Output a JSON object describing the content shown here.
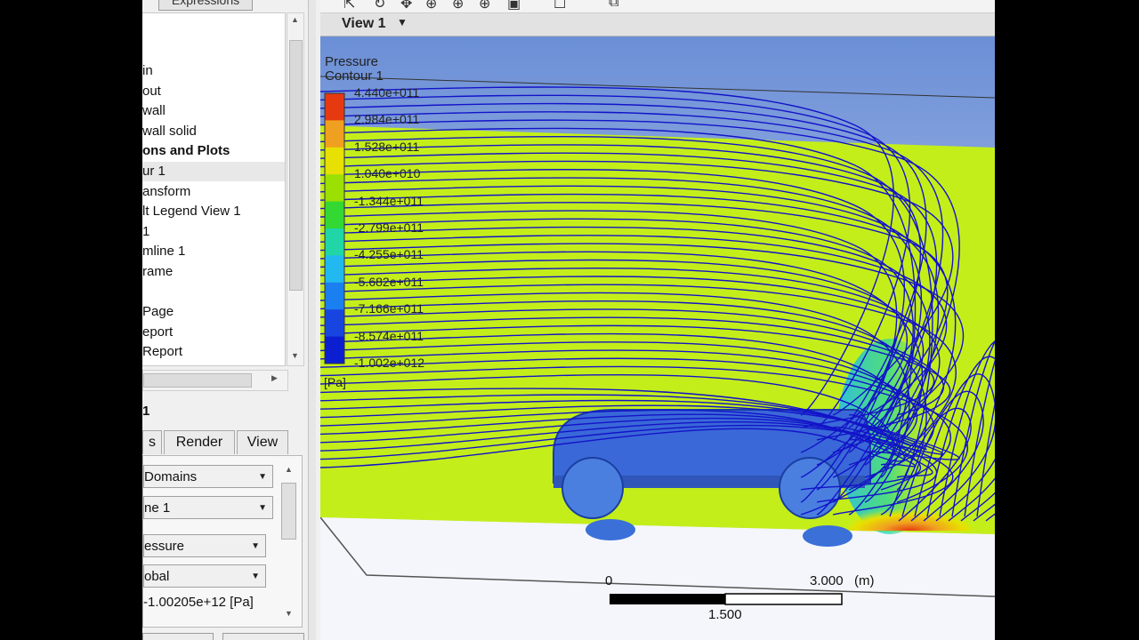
{
  "left_panel": {
    "top_tab": "Expressions",
    "tree_items": [
      {
        "label": "in",
        "bold": false,
        "selected": false
      },
      {
        "label": "out",
        "bold": false,
        "selected": false
      },
      {
        "label": "wall",
        "bold": false,
        "selected": false
      },
      {
        "label": "wall solid",
        "bold": false,
        "selected": false
      },
      {
        "label": "ons and Plots",
        "bold": true,
        "selected": false
      },
      {
        "label": "ur 1",
        "bold": false,
        "selected": true
      },
      {
        "label": "ansform",
        "bold": false,
        "selected": false
      },
      {
        "label": "lt Legend View 1",
        "bold": false,
        "selected": false
      },
      {
        "label": "1",
        "bold": false,
        "selected": false
      },
      {
        "label": "mline 1",
        "bold": false,
        "selected": false
      },
      {
        "label": "rame",
        "bold": false,
        "selected": false
      },
      {
        "label": "",
        "bold": false,
        "selected": false
      },
      {
        "label": "Page",
        "bold": false,
        "selected": false
      },
      {
        "label": "eport",
        "bold": false,
        "selected": false
      },
      {
        "label": "Report",
        "bold": false,
        "selected": false
      }
    ],
    "details_title": "1",
    "tabs": [
      {
        "label": "s",
        "active": false
      },
      {
        "label": "Render",
        "active": false
      },
      {
        "label": "View",
        "active": false
      }
    ],
    "domains_value": "Domains",
    "locations_value": "ne 1",
    "variable_value": "essure",
    "range_value": "obal",
    "min_value_text": "-1.00205e+12 [Pa]"
  },
  "viewer": {
    "view_title": "View 1",
    "legend": {
      "title_line1": "Pressure",
      "title_line2": "Contour 1",
      "unit": "[Pa]",
      "labels": [
        "4.440e+011",
        "2.984e+011",
        "1.528e+011",
        "1.040e+010",
        "-1.344e+011",
        "-2.799e+011",
        "-4.255e+011",
        "-5.682e+011",
        "-7.166e+011",
        "-8.574e+011",
        "-1.002e+012"
      ],
      "colors": [
        "#e53a10",
        "#f0a020",
        "#e8e000",
        "#9be000",
        "#33d833",
        "#20d6a6",
        "#21b9f0",
        "#1a7ff0",
        "#1845e0",
        "#0b1fd0"
      ]
    },
    "scale": {
      "left_tick": "0",
      "right_tick": "3.000",
      "unit": "(m)",
      "mid_label": "1.500"
    }
  }
}
